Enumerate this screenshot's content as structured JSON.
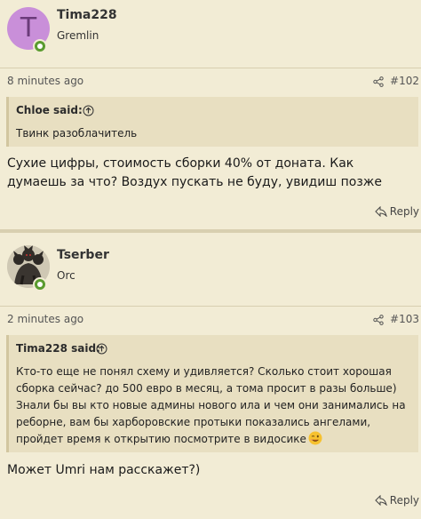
{
  "posts": [
    {
      "username": "Tima228",
      "user_title": "Gremlin",
      "avatar_letter": "T",
      "time": "8 minutes ago",
      "post_number": "#102",
      "quote_author": "Chloe said:",
      "quote_text": "Твинк разоблачитель",
      "message": "Сухие цифры, стоимость сборки 40% от доната. Как думаешь за что? Воздух пускать не буду, увидиш позже",
      "reply_label": "Reply"
    },
    {
      "username": "Tserber",
      "user_title": "Orc",
      "time": "2 minutes ago",
      "post_number": "#103",
      "quote_author": "Tima228 said:",
      "quote_text": "Кто-то еще не понял схему и удивляется? Сколько стоит хорошая сборка сейчас? до 500 евро в месяц, а тома просит в разы больше) Знали бы вы кто новые админы нового ила и чем они занимались на реборне, вам бы харборовские протыки показались ангелами, пройдет время к открытию посмотрите в видосике",
      "message": "Может Umri нам расскажет?)",
      "reply_label": "Reply"
    }
  ],
  "colors": {
    "background": "#f2ecd5",
    "quote_background": "#e8dfc1",
    "online": "#5a9b2f",
    "avatar_bg": "#c98fd9"
  },
  "icons": [
    "share-icon",
    "quote-arrow-icon",
    "reply-icon",
    "online-status-icon",
    "wink-emoji-icon"
  ]
}
